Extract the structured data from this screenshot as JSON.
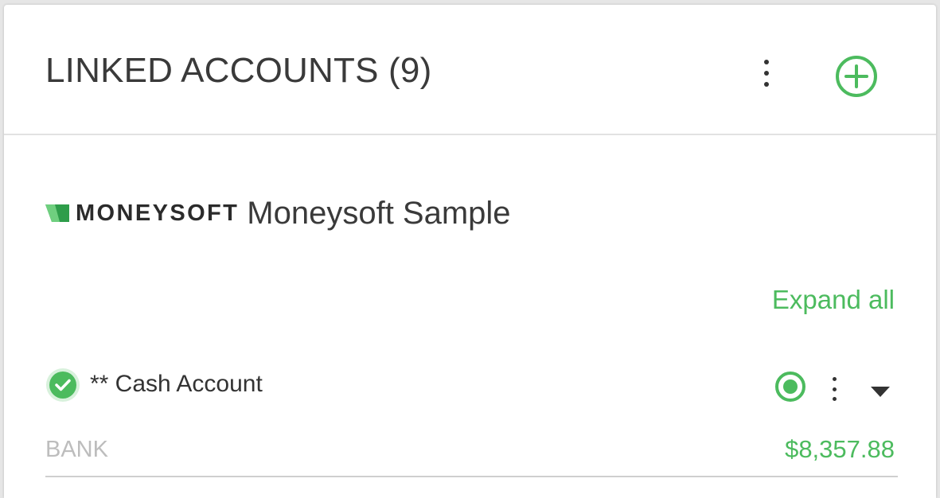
{
  "header": {
    "title": "LINKED ACCOUNTS (9)",
    "more_icon": "more-vert-icon",
    "add_icon": "add-circle-icon"
  },
  "provider": {
    "logo_text": "MONEYSOFT",
    "name": "Moneysoft Sample"
  },
  "expand_all_label": "Expand all",
  "accounts": [
    {
      "name": "** Cash Account",
      "type": "BANK",
      "balance": "$8,357.88",
      "status_icon": "check-circle-icon",
      "selected": true
    }
  ],
  "colors": {
    "accent": "#4cbb5e",
    "title_text": "#3a3a3a",
    "muted_text": "#bdbdbd",
    "divider": "#e2e2e2",
    "background": "#e6e6e6"
  }
}
